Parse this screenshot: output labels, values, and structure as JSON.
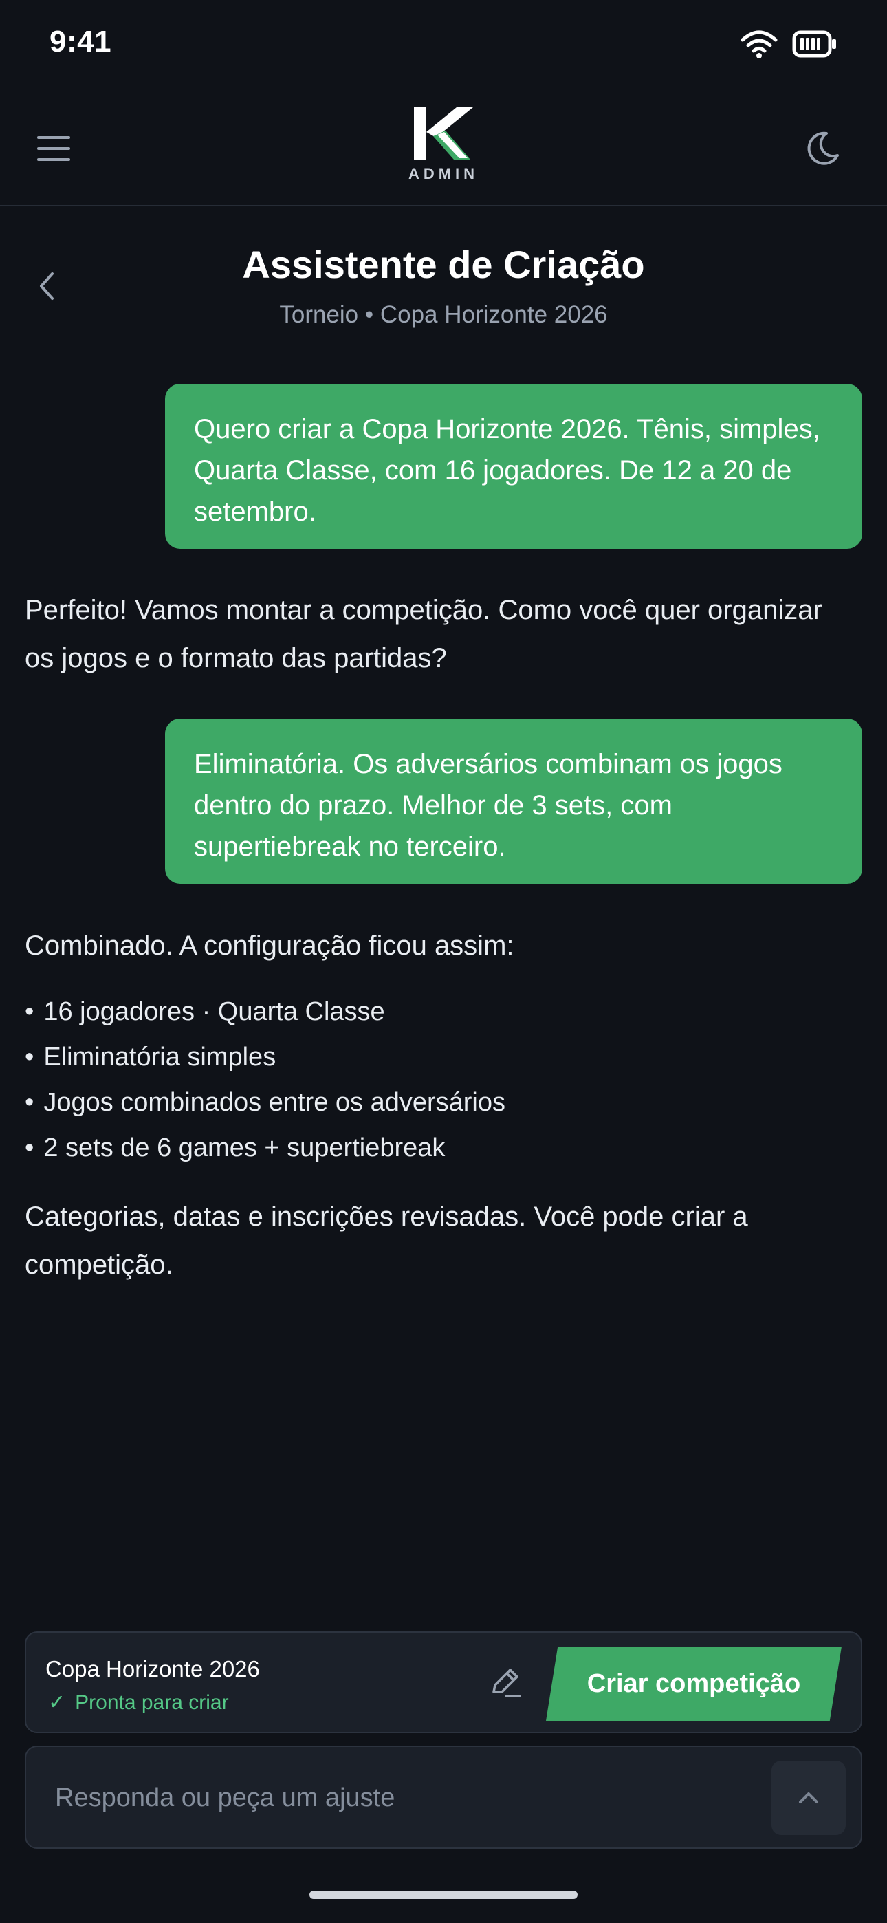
{
  "status_bar": {
    "time": "9:41"
  },
  "nav": {
    "logo_text": "ADMIN"
  },
  "header": {
    "title": "Assistente de Criação",
    "subtitle": "Torneio • Copa Horizonte 2026"
  },
  "chat": {
    "messages": [
      {
        "role": "user",
        "text": "Quero criar a Copa Horizonte 2026. Tênis, simples, Quarta Classe, com 16 jogadores. De 12 a 20 de setembro."
      },
      {
        "role": "assistant",
        "text": "Perfeito! Vamos montar a competição. Como você quer organizar os jogos e o formato das partidas?"
      },
      {
        "role": "user",
        "text": "Eliminatória. Os adversários combinam os jogos dentro do prazo. Melhor de 3 sets, com supertiebreak no terceiro."
      },
      {
        "role": "assistant",
        "intro": "Combinado. A configuração ficou assim:",
        "bullets": [
          "16 jogadores · Quarta Classe",
          "Eliminatória simples",
          "Jogos combinados entre os adversários",
          "2 sets de 6 games + supertiebreak"
        ],
        "outro": "Categorias, datas e inscrições revisadas. Você pode criar a competição."
      }
    ]
  },
  "ready_card": {
    "name": "Copa Horizonte 2026",
    "status": "Pronta para criar",
    "create_label": "Criar competição"
  },
  "composer": {
    "placeholder": "Responda ou peça um ajuste"
  },
  "colors": {
    "background": "#0f1218",
    "accent": "#3ea966",
    "ready_status": "#55c987"
  },
  "icons": [
    "menu-icon",
    "moon-icon",
    "chevron-left-icon",
    "pencil-icon",
    "check-icon",
    "chevron-up-icon",
    "wifi-icon",
    "battery-icon"
  ]
}
